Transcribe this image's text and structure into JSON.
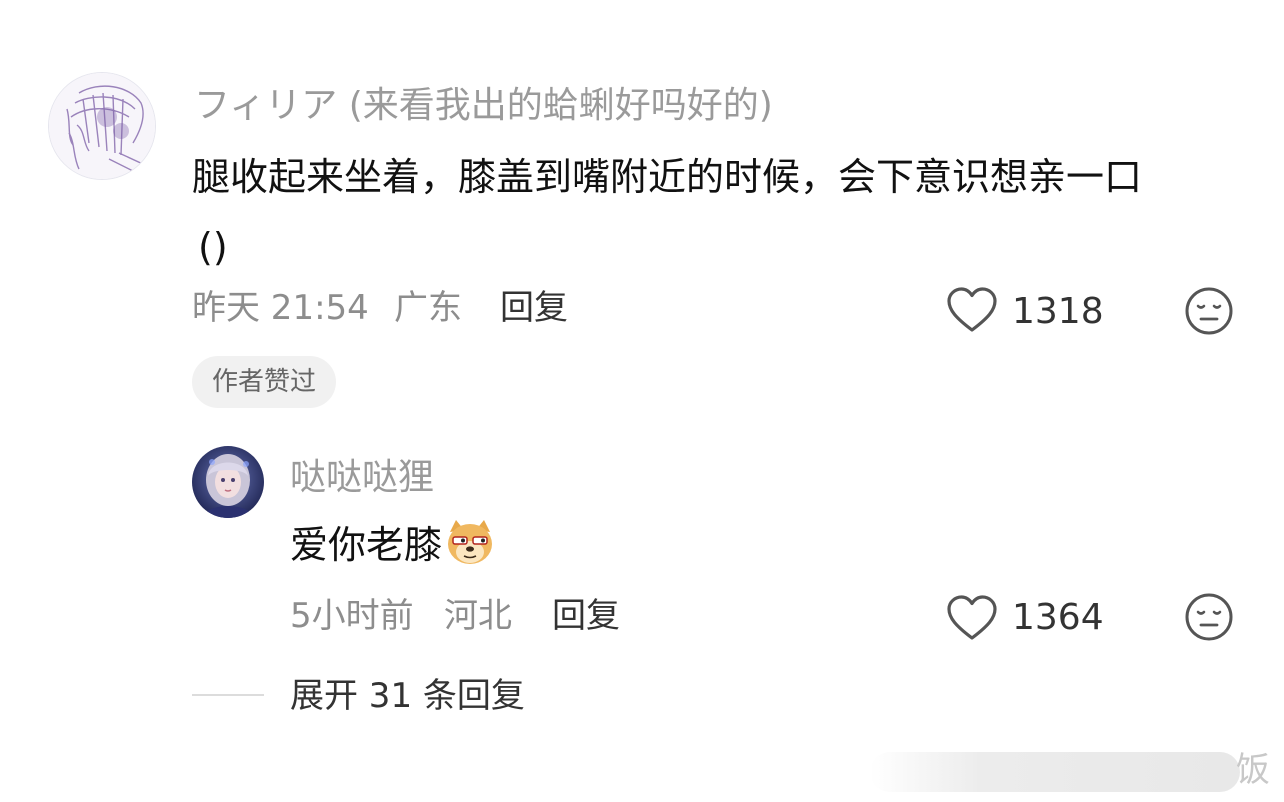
{
  "comment": {
    "username": "フィリア (来看我出的蛤蜊好吗好的)",
    "text_line1": "腿收起来坐着，膝盖到嘴附近的时候，会下意识想亲一口",
    "text_line2": "()",
    "time": "昨天 21:54",
    "location": "广东",
    "reply_label": "回复",
    "like_count": "1318",
    "badge": "作者赞过"
  },
  "reply": {
    "username": "哒哒哒狸",
    "text": "爱你老膝",
    "emoji_name": "doge-emoji",
    "time": "5小时前",
    "location": "河北",
    "reply_label": "回复",
    "like_count": "1364"
  },
  "expand": {
    "label": "展开 31 条回复"
  },
  "watermark": {
    "char": "饭"
  },
  "colors": {
    "username_gray": "#9a9a9a",
    "meta_gray": "#8d8d8d",
    "badge_bg": "#f1f1f1"
  }
}
